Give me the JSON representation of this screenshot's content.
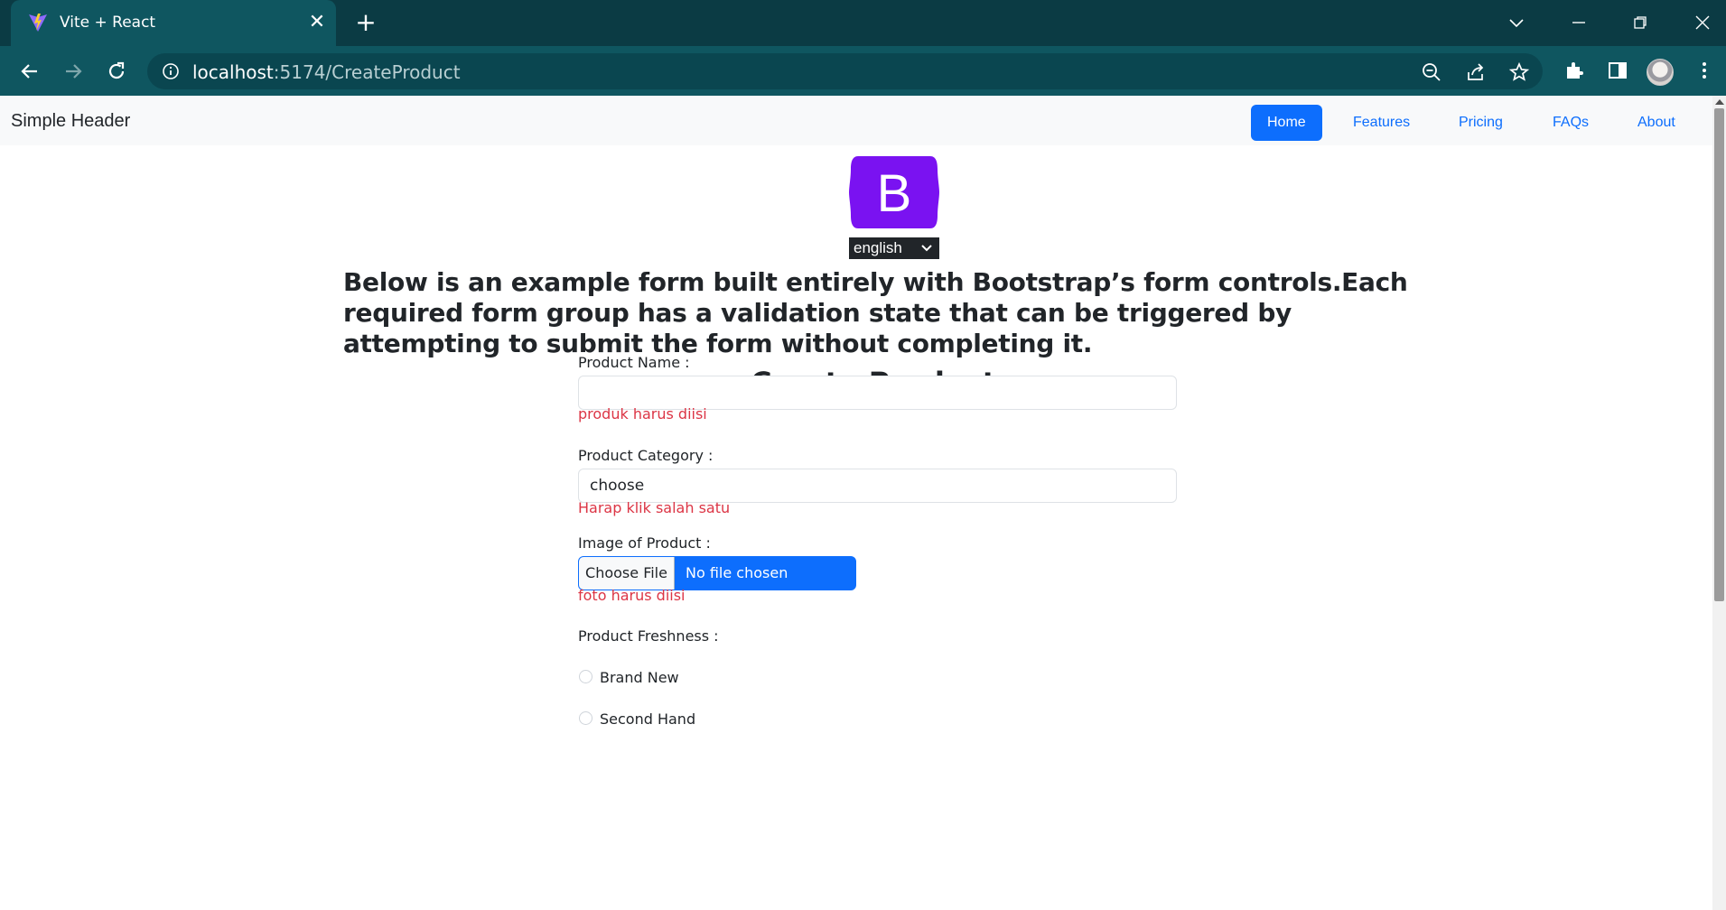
{
  "browser": {
    "tab_title": "Vite + React",
    "tab_close": "✕",
    "new_tab": "+",
    "url_host": "localhost",
    "url_rest": ":5174/CreateProduct",
    "window_controls": {
      "list": "⌄",
      "minimize": "—",
      "restore": "❐",
      "close": "✕"
    }
  },
  "header": {
    "brand": "Simple Header",
    "nav": [
      "Home",
      "Features",
      "Pricing",
      "FAQs",
      "About"
    ],
    "active": "Home"
  },
  "logo": {
    "letter": "B",
    "color": "#7a12f1"
  },
  "language": {
    "selected": "english"
  },
  "intro": "Below is an example form built entirely with Bootstrap’s form controls.Each required form group has a validation state that can be triggered by attempting to submit the form without completing it.",
  "form": {
    "title": "Create Product",
    "product_name": {
      "label": "Product Name :",
      "value": "",
      "error": "produk harus diisi"
    },
    "product_category": {
      "label": "Product Category :",
      "value": "choose",
      "error": "Harap klik salah satu"
    },
    "image": {
      "label": "Image of Product :",
      "button": "Choose File",
      "status": "No file chosen",
      "error": "foto harus diisi"
    },
    "freshness": {
      "label": "Product Freshness :",
      "options": [
        "Brand New",
        "Second Hand"
      ]
    }
  },
  "colors": {
    "primary": "#0d6efd",
    "danger": "#dc3545",
    "chrome_dark": "#0b3b44",
    "chrome_toolbar": "#0f5660"
  },
  "icons": [
    "vite-favicon-icon",
    "back-arrow-icon",
    "forward-arrow-icon",
    "reload-icon",
    "info-icon",
    "zoom-out-icon",
    "share-icon",
    "star-icon",
    "extensions-icon",
    "side-panel-icon",
    "kebab-menu-icon"
  ]
}
